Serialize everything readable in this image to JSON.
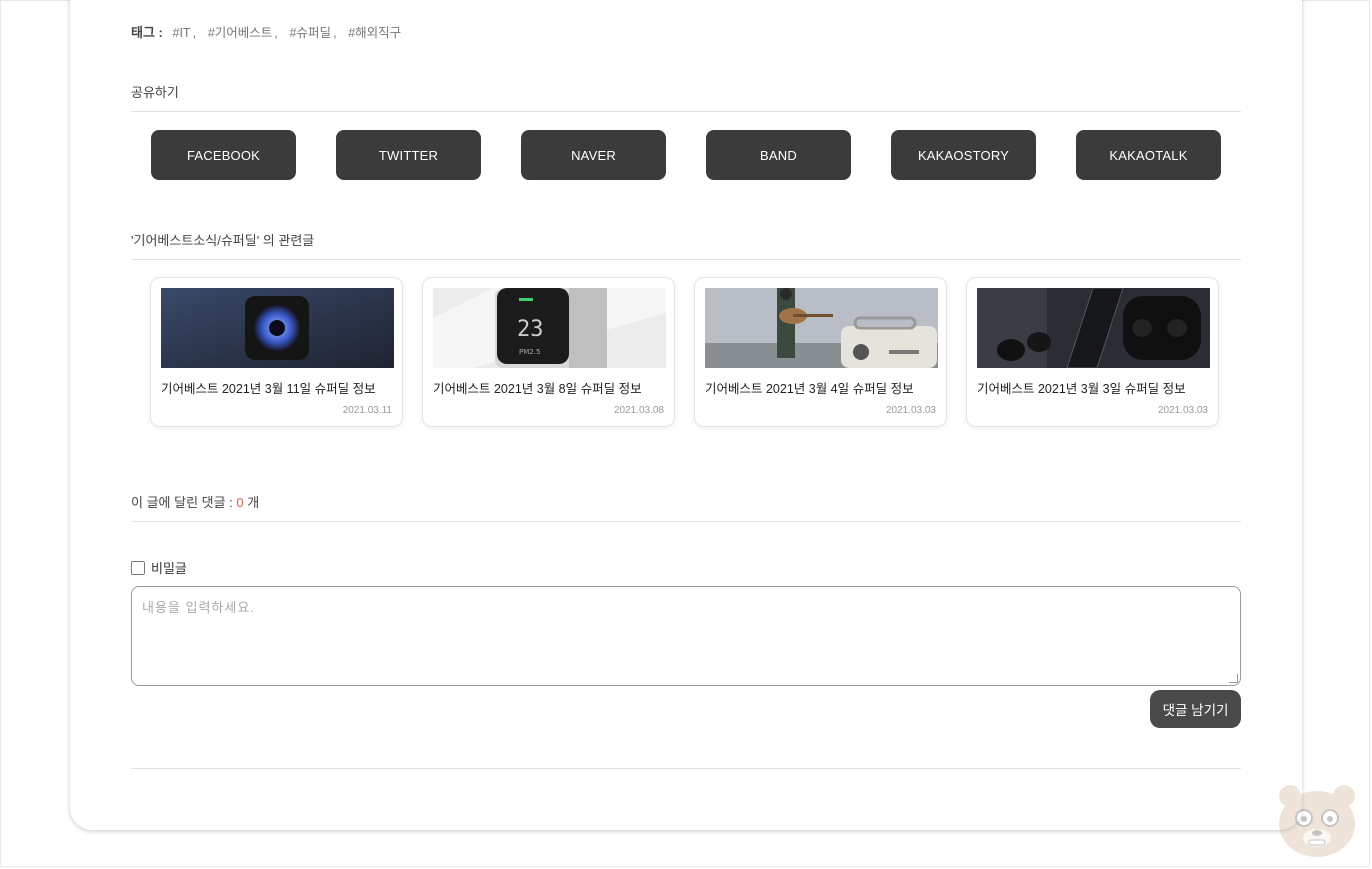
{
  "tags": {
    "label": "태그 :",
    "items": [
      "#IT",
      "#기어베스트",
      "#슈퍼딜",
      "#해외직구"
    ]
  },
  "share": {
    "title": "공유하기",
    "buttons": [
      "FACEBOOK",
      "TWITTER",
      "NAVER",
      "BAND",
      "KAKAOSTORY",
      "KAKAOTALK"
    ]
  },
  "related": {
    "title": "'기어베스트소식/슈퍼딜' 의 관련글",
    "posts": [
      {
        "title": "기어베스트 2021년 3월 11일 슈퍼딜 정보",
        "date": "2021.03.11",
        "image": "tv-box-photo"
      },
      {
        "title": "기어베스트 2021년 3월 8일 슈퍼딜 정보",
        "date": "2021.03.08",
        "image": "air-monitor-photo"
      },
      {
        "title": "기어베스트 2021년 3월 4일 슈퍼딜 정보",
        "date": "2021.03.03",
        "image": "guitar-speaker-photo"
      },
      {
        "title": "기어베스트 2021년 3월 3일 슈퍼딜 정보",
        "date": "2021.03.03",
        "image": "earbuds-photo"
      }
    ]
  },
  "comments": {
    "title_prefix": "이 글에 달린 댓글 : ",
    "count": "0",
    "title_suffix": " 개",
    "secret_label": "비밀글",
    "placeholder": "내용을 입력하세요.",
    "submit_label": "댓글 남기기"
  },
  "colors": {
    "button_bg": "#3b3b3b",
    "comment_count": "#e05a4e"
  }
}
